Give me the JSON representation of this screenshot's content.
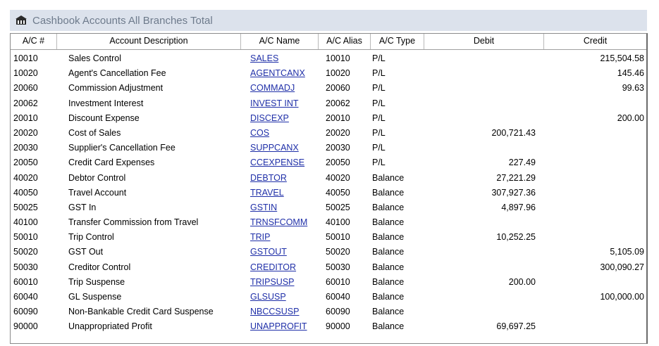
{
  "window": {
    "title": "Cashbook Accounts All Branches Total",
    "icon": "cashbook-icon"
  },
  "columns": [
    "A/C #",
    "Account Description",
    "A/C Name",
    "A/C Alias",
    "A/C Type",
    "Debit",
    "Credit"
  ],
  "rows": [
    {
      "ac": "10010",
      "desc": "Sales Control",
      "name": "SALES",
      "alias": "10010",
      "type": "P/L",
      "debit": "",
      "credit": "215,504.58"
    },
    {
      "ac": "10020",
      "desc": "Agent's Cancellation Fee",
      "name": "AGENTCANX",
      "alias": "10020",
      "type": "P/L",
      "debit": "",
      "credit": "145.46"
    },
    {
      "ac": "20060",
      "desc": "Commission Adjustment",
      "name": "COMMADJ",
      "alias": "20060",
      "type": "P/L",
      "debit": "",
      "credit": "99.63"
    },
    {
      "ac": "20062",
      "desc": "Investment Interest",
      "name": "INVEST INT",
      "alias": "20062",
      "type": "P/L",
      "debit": "",
      "credit": ""
    },
    {
      "ac": "20010",
      "desc": "Discount Expense",
      "name": "DISCEXP",
      "alias": "20010",
      "type": "P/L",
      "debit": "",
      "credit": "200.00"
    },
    {
      "ac": "20020",
      "desc": "Cost of Sales",
      "name": "COS",
      "alias": "20020",
      "type": "P/L",
      "debit": "200,721.43",
      "credit": ""
    },
    {
      "ac": "20030",
      "desc": "Supplier's Cancellation Fee",
      "name": "SUPPCANX",
      "alias": "20030",
      "type": "P/L",
      "debit": "",
      "credit": ""
    },
    {
      "ac": "20050",
      "desc": "Credit Card Expenses",
      "name": "CCEXPENSE",
      "alias": "20050",
      "type": "P/L",
      "debit": "227.49",
      "credit": ""
    },
    {
      "ac": "40020",
      "desc": "Debtor Control",
      "name": "DEBTOR",
      "alias": "40020",
      "type": "Balance",
      "debit": "27,221.29",
      "credit": ""
    },
    {
      "ac": "40050",
      "desc": "Travel Account",
      "name": "TRAVEL",
      "alias": "40050",
      "type": "Balance",
      "debit": "307,927.36",
      "credit": ""
    },
    {
      "ac": "50025",
      "desc": "GST In",
      "name": "GSTIN",
      "alias": "50025",
      "type": "Balance",
      "debit": "4,897.96",
      "credit": ""
    },
    {
      "ac": "40100",
      "desc": "Transfer Commission from Travel",
      "name": "TRNSFCOMM",
      "alias": "40100",
      "type": "Balance",
      "debit": "",
      "credit": ""
    },
    {
      "ac": "50010",
      "desc": "Trip Control",
      "name": "TRIP",
      "alias": "50010",
      "type": "Balance",
      "debit": "10,252.25",
      "credit": ""
    },
    {
      "ac": "50020",
      "desc": "GST Out",
      "name": "GSTOUT",
      "alias": "50020",
      "type": "Balance",
      "debit": "",
      "credit": "5,105.09"
    },
    {
      "ac": "50030",
      "desc": "Creditor Control",
      "name": "CREDITOR",
      "alias": "50030",
      "type": "Balance",
      "debit": "",
      "credit": "300,090.27"
    },
    {
      "ac": "60010",
      "desc": "Trip Suspense",
      "name": "TRIPSUSP",
      "alias": "60010",
      "type": "Balance",
      "debit": "200.00",
      "credit": ""
    },
    {
      "ac": "60040",
      "desc": "GL Suspense",
      "name": "GLSUSP",
      "alias": "60040",
      "type": "Balance",
      "debit": "",
      "credit": "100,000.00"
    },
    {
      "ac": "60090",
      "desc": "Non-Bankable Credit Card Suspense",
      "name": "NBCCSUSP",
      "alias": "60090",
      "type": "Balance",
      "debit": "",
      "credit": ""
    },
    {
      "ac": "90000",
      "desc": "Unappropriated Profit",
      "name": "UNAPPROFIT",
      "alias": "90000",
      "type": "Balance",
      "debit": "69,697.25",
      "credit": ""
    }
  ]
}
